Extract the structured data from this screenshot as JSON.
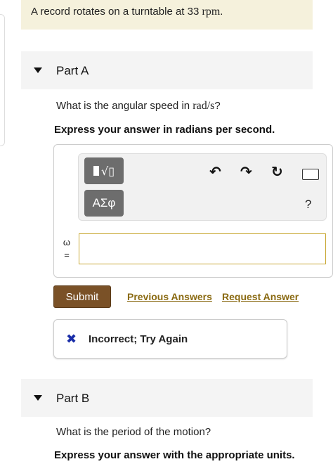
{
  "intro": {
    "prefix": "A record rotates on a turntable at 33 ",
    "unit": "rpm",
    "suffix": "."
  },
  "part_a": {
    "title": "Part A",
    "question_prefix": "What is the angular speed in ",
    "question_unit": "rad/s",
    "question_suffix": "?",
    "instruction": "Express your answer in radians per second.",
    "variable_symbol": "ω",
    "variable_equals": "=",
    "answer_value": ""
  },
  "toolbar": {
    "templates_icon": "radical-template-icon",
    "greek_label": "ΑΣφ",
    "undo_icon": "↶",
    "redo_icon": "↷",
    "reset_icon": "↻",
    "keyboard_icon": "keyboard-icon",
    "help_label": "?"
  },
  "actions": {
    "submit_label": "Submit",
    "previous_answers_label": "Previous Answers",
    "request_answer_label": "Request Answer"
  },
  "feedback": {
    "icon": "✖",
    "message": "Incorrect; Try Again"
  },
  "part_b": {
    "title": "Part B",
    "question": "What is the period of the motion?",
    "instruction": "Express your answer with the appropriate units."
  },
  "colors": {
    "intro_bg": "#f5f1dc",
    "submit_bg": "#7a5127",
    "link": "#8a6a12",
    "incorrect_icon": "#1a2ea8",
    "input_border": "#c9a937"
  }
}
